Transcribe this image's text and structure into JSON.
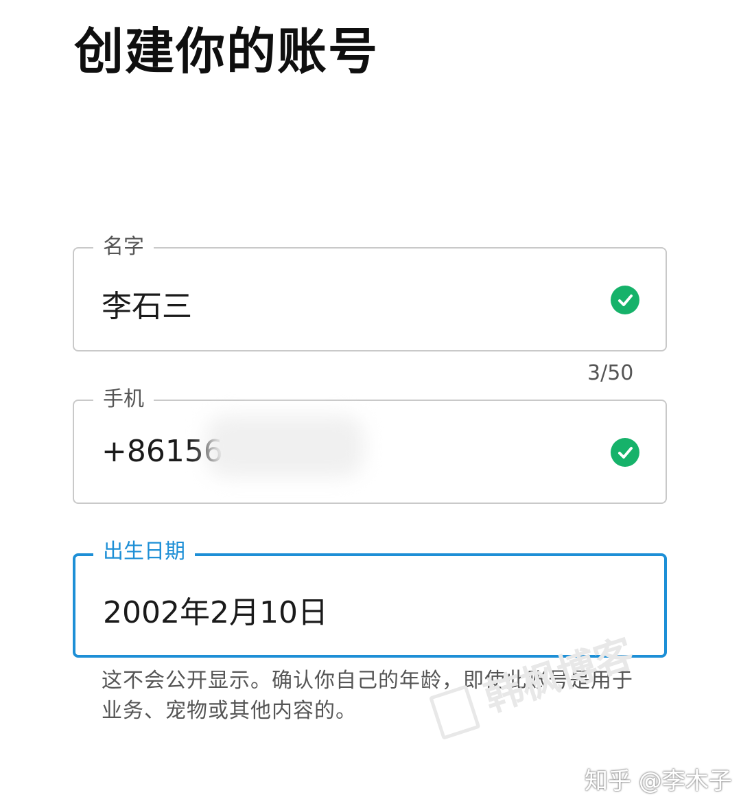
{
  "page": {
    "title": "创建你的账号"
  },
  "form": {
    "name_field": {
      "label": "名字",
      "value": "李石三",
      "counter": "3/50",
      "icon": "check-circle-icon",
      "icon_color": "#16b26a"
    },
    "phone_field": {
      "label": "手机",
      "value": "+86156",
      "icon": "check-circle-icon",
      "icon_color": "#16b26a"
    },
    "birthday_field": {
      "label": "出生日期",
      "value": "2002年2月10日",
      "accent_color": "#1d8fd6"
    },
    "helper_text": "这不会公开显示。确认你自己的年龄，即使此账号是用于业务、宠物或其他内容的。"
  },
  "watermarks": {
    "blog": "韩枫博客",
    "zhihu": "知乎 @李木子"
  }
}
